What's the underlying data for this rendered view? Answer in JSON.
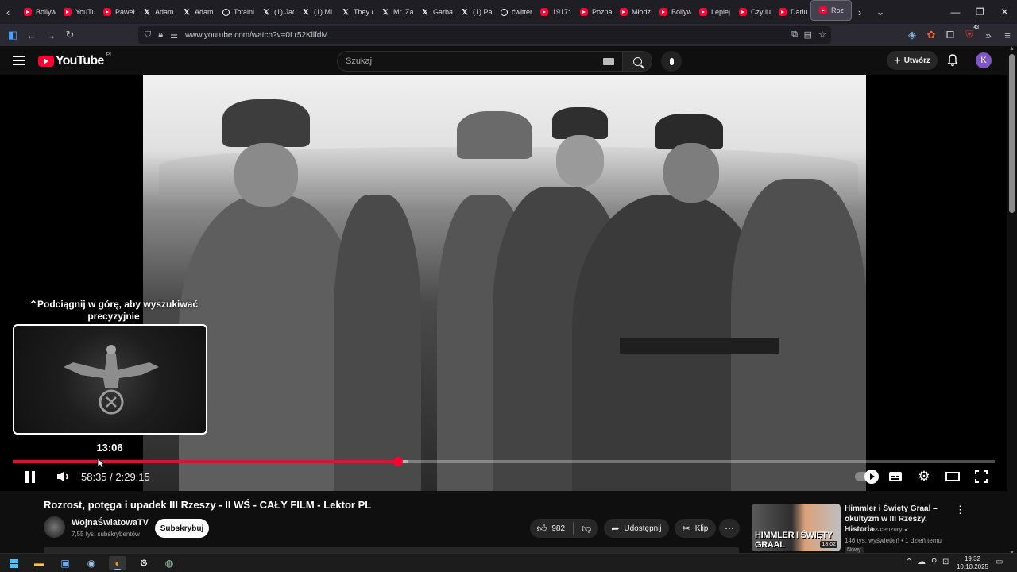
{
  "browser": {
    "tabs": [
      {
        "label": "Bollyw",
        "icon": "youtube-icon"
      },
      {
        "label": "YouTu",
        "icon": "youtube-icon"
      },
      {
        "label": "Paweł",
        "icon": "youtube-icon"
      },
      {
        "label": "Adam",
        "icon": "x-icon"
      },
      {
        "label": "Adam",
        "icon": "x-icon"
      },
      {
        "label": "Totalni",
        "icon": "threads-icon"
      },
      {
        "label": "(1) Jac",
        "icon": "x-icon"
      },
      {
        "label": "(1) Mi",
        "icon": "x-icon"
      },
      {
        "label": "They c",
        "icon": "x-icon"
      },
      {
        "label": "Mr. Za",
        "icon": "x-icon"
      },
      {
        "label": "Garba",
        "icon": "x-icon"
      },
      {
        "label": "(1) Pa",
        "icon": "x-icon"
      },
      {
        "label": "ćwitter",
        "icon": "threads-icon"
      },
      {
        "label": "1917:",
        "icon": "youtube-icon"
      },
      {
        "label": "Pozna",
        "icon": "youtube-icon"
      },
      {
        "label": "Młodz",
        "icon": "youtube-icon"
      },
      {
        "label": "Bollyw",
        "icon": "youtube-icon"
      },
      {
        "label": "Lepiej",
        "icon": "youtube-icon"
      },
      {
        "label": "Czy lu",
        "icon": "youtube-icon"
      },
      {
        "label": "Dariu",
        "icon": "youtube-icon"
      },
      {
        "label": "Roz",
        "icon": "youtube-icon",
        "active": true
      }
    ],
    "url": "www.youtube.com/watch?v=0Lr52KllfdM",
    "extensions_badge": "43"
  },
  "youtube": {
    "logo_text": "YouTube",
    "country_code": "PL",
    "search_placeholder": "Szukaj",
    "create_label": "Utwórz",
    "avatar_letter": "K"
  },
  "player": {
    "seek_hint": "Podciągnij w górę, aby wyszukiwać precyzyjnie",
    "preview_time": "13:06",
    "current_time": "58:35",
    "duration": "2:29:15",
    "time_display": "58:35 / 2:29:15",
    "played_fraction": 0.3925,
    "hover_fraction": 0.0877
  },
  "video": {
    "title": "Rozrost, potęga i upadek III Rzeszy - II WŚ - CAŁY FILM - Lektor PL",
    "channel": "WojnaŚwiatowaTV",
    "subscribers": "7,55 tys. subskrybentów",
    "subscribe_label": "Subskrybuj",
    "likes": "982",
    "share_label": "Udostępnij",
    "clip_label": "Klip"
  },
  "recommendation": {
    "title": "Himmler i Święty Graal – okultyzm w III Rzeszy. Historia…",
    "channel": "Historia bez cenzury",
    "meta": "146 tys. wyświetleń • 1 dzień temu",
    "badge": "Nowy",
    "thumb_text": "HIMMLER I ŚWIĘTY GRAAL",
    "duration": "18:02"
  },
  "taskbar": {
    "time": "19:32",
    "date": "10.10.2025"
  },
  "colors": {
    "accent": "#ff0033",
    "background": "#0f0f0f"
  }
}
